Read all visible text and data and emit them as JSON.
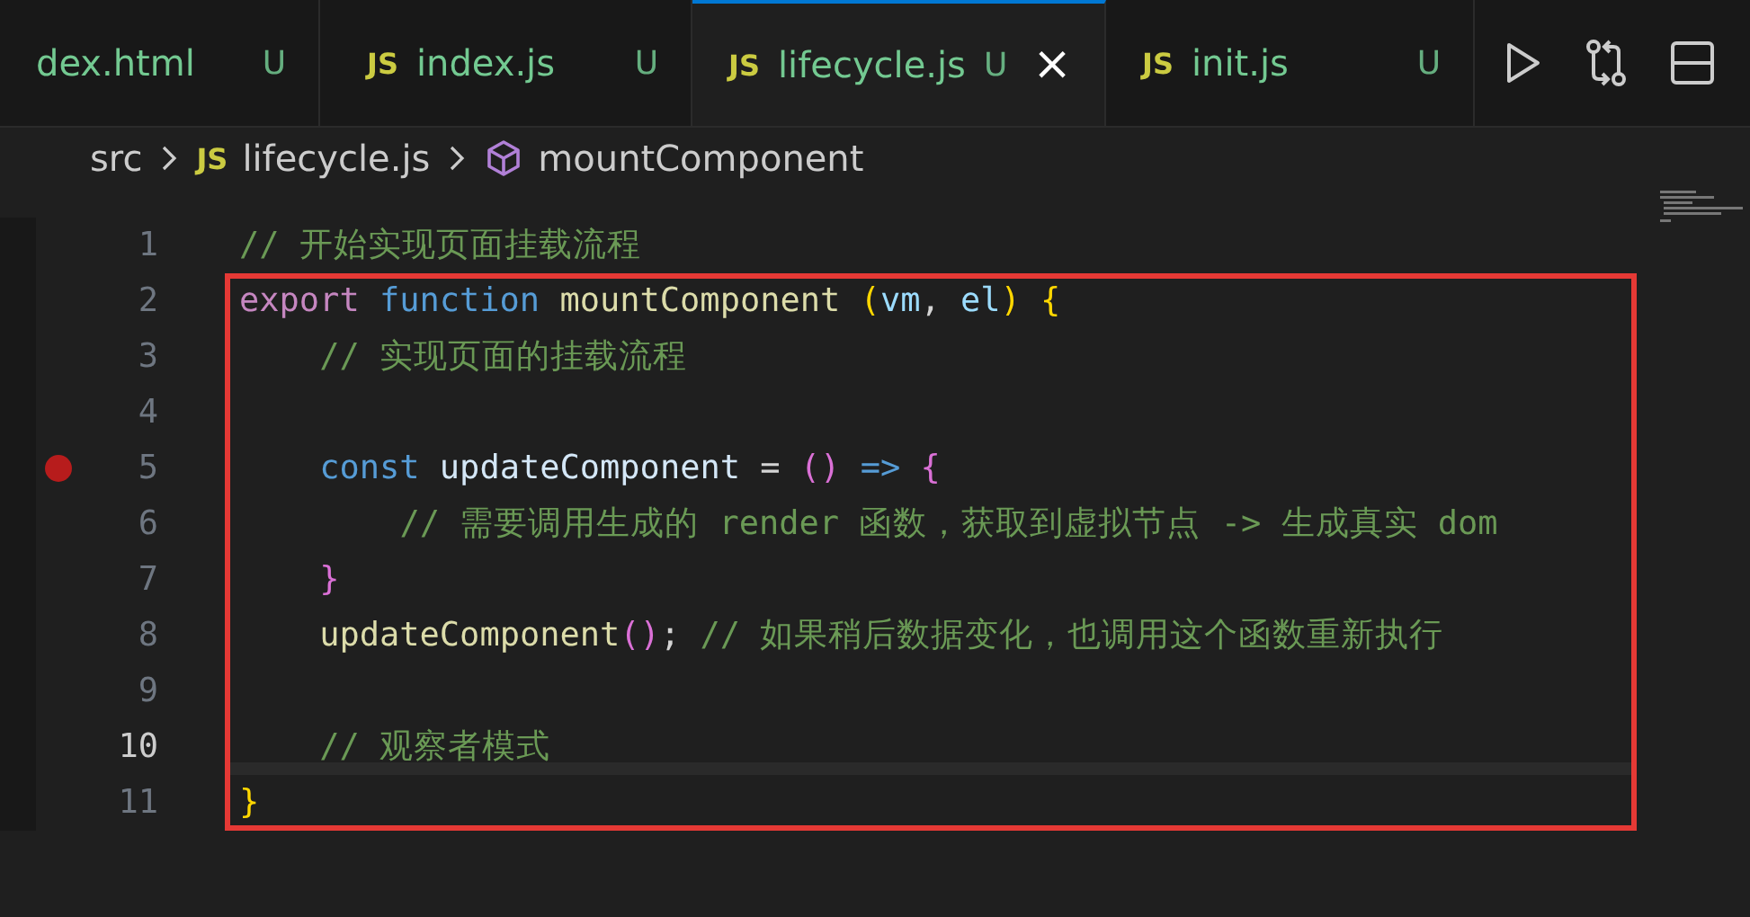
{
  "tabs": [
    {
      "label": "dex.html",
      "status": "U",
      "selected": false
    },
    {
      "badge": "JS",
      "label": "index.js",
      "status": "U",
      "selected": false
    },
    {
      "badge": "JS",
      "label": "lifecycle.js",
      "status": "U",
      "close": "×",
      "selected": true
    },
    {
      "badge": "JS",
      "label": "init.js",
      "status": "U",
      "selected": false
    }
  ],
  "breadcrumbs": [
    {
      "kind": "folder",
      "label": "src"
    },
    {
      "kind": "file",
      "badge": "JS",
      "label": "lifecycle.js"
    },
    {
      "kind": "symbol",
      "label": "mountComponent"
    }
  ],
  "lines": [
    {
      "number": "1",
      "breakpoint": false,
      "current": false,
      "highlighted": false,
      "tokens": [
        {
          "kind": "comment",
          "text": "// 开始实现页面挂载流程"
        }
      ]
    },
    {
      "number": "2",
      "breakpoint": false,
      "current": false,
      "highlighted": true,
      "tokens": [
        {
          "kind": "keyword",
          "text": "export "
        },
        {
          "kind": "storage",
          "text": "function "
        },
        {
          "kind": "function",
          "text": "mountComponent "
        },
        {
          "kind": "bracket1",
          "text": "("
        },
        {
          "kind": "variable",
          "text": "vm"
        },
        {
          "kind": "plain",
          "text": ", "
        },
        {
          "kind": "variable",
          "text": "el"
        },
        {
          "kind": "bracket1",
          "text": ") {"
        }
      ],
      "children": [
        {
          "number": "3",
          "breakpoint": false,
          "current": false,
          "highlighted": true,
          "tokens": [
            {
              "kind": "comment",
              "text": "// 实现页面的挂载流程"
            }
          ]
        },
        {
          "number": "4",
          "breakpoint": false,
          "current": false,
          "highlighted": true
        },
        {
          "number": "5",
          "breakpoint": true,
          "current": false,
          "highlighted": true,
          "tokens": [
            {
              "kind": "storage",
              "text": "const "
            },
            {
              "kind": "constant",
              "text": "updateComponent"
            },
            {
              "kind": "plain",
              "text": " = "
            },
            {
              "kind": "bracket2",
              "text": "()"
            },
            {
              "kind": "storage",
              "text": " => "
            },
            {
              "kind": "bracket2",
              "text": "{"
            }
          ],
          "children": [
            {
              "number": "6",
              "breakpoint": false,
              "current": false,
              "highlighted": true,
              "tokens": [
                {
                  "kind": "comment",
                  "text": "// 需要调用生成的 render 函数，获取到虚拟节点 -> 生成真实 dom"
                }
              ]
            }
          ]
        },
        {
          "number": "7",
          "breakpoint": false,
          "current": false,
          "highlighted": true,
          "tokens": [
            {
              "kind": "bracket2",
              "text": "}"
            }
          ]
        },
        {
          "number": "8",
          "breakpoint": false,
          "current": false,
          "highlighted": true,
          "tokens": [
            {
              "kind": "function",
              "text": "updateComponent"
            },
            {
              "kind": "bracket2",
              "text": "()"
            },
            {
              "kind": "plain",
              "text": "; "
            },
            {
              "kind": "comment",
              "text": "// 如果稍后数据变化，也调用这个函数重新执行"
            }
          ]
        },
        {
          "number": "9",
          "breakpoint": false,
          "current": false,
          "highlighted": true
        },
        {
          "number": "10",
          "breakpoint": false,
          "current": true,
          "highlighted": true,
          "tokens": [
            {
              "kind": "comment",
              "text": "// 观察者模式"
            }
          ]
        }
      ]
    },
    {
      "number": "11",
      "breakpoint": false,
      "current": false,
      "highlighted": true,
      "tokens": [
        {
          "kind": "bracket1",
          "text": "}"
        }
      ]
    }
  ]
}
